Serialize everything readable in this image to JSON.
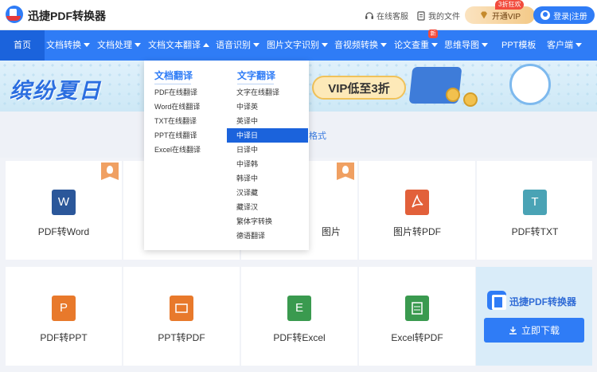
{
  "header": {
    "app_name": "迅捷PDF转换器",
    "online_service": "在线客服",
    "my_files": "我的文件",
    "vip_button": "开通VIP",
    "vip_badge": "3折狂欢",
    "login": "登录|注册"
  },
  "nav": {
    "items": [
      {
        "label": "首页"
      },
      {
        "label": "文档转换"
      },
      {
        "label": "文档处理"
      },
      {
        "label": "文档文本翻译"
      },
      {
        "label": "语音识别"
      },
      {
        "label": "图片文字识别"
      },
      {
        "label": "音视频转换"
      },
      {
        "label": "论文查重"
      },
      {
        "label": "思维导图"
      },
      {
        "label": "PPT模板"
      },
      {
        "label": "客户端"
      }
    ],
    "new_badge": "新"
  },
  "banner": {
    "title": "缤纷夏日",
    "vip_text": "VIP低至3折"
  },
  "format_strip_text": "格式",
  "dropdown": {
    "doc_title": "文档翻译",
    "doc_items": [
      "PDF在线翻译",
      "Word在线翻译",
      "TXT在线翻译",
      "PPT在线翻译",
      "Excel在线翻译"
    ],
    "text_title": "文字翻译",
    "text_items": [
      "文字在线翻译",
      "中译英",
      "英译中",
      "中译日",
      "日译中",
      "中译韩",
      "韩译中",
      "汉译藏",
      "藏译汉",
      "繁体字转换",
      "德语翻译"
    ],
    "selected": "中译日"
  },
  "cards": {
    "row1": [
      {
        "label": "PDF转Word",
        "tile": "W",
        "color": "#2b579a"
      },
      {
        "label": "",
        "tile": "",
        "color": ""
      },
      {
        "label": "图片",
        "tile": "",
        "color": ""
      },
      {
        "label": "图片转PDF",
        "tile": "",
        "color": "#e2603a"
      },
      {
        "label": "PDF转TXT",
        "tile": "T",
        "color": "#4aa3b5"
      }
    ],
    "row2": [
      {
        "label": "PDF转PPT",
        "tile": "P",
        "color": "#e8792b"
      },
      {
        "label": "PPT转PDF",
        "tile": "",
        "color": "#e8792b"
      },
      {
        "label": "PDF转Excel",
        "tile": "E",
        "color": "#3a9a4f"
      },
      {
        "label": "Excel转PDF",
        "tile": "",
        "color": "#3a9a4f"
      }
    ]
  },
  "download": {
    "title": "迅捷PDF转换器",
    "button": "立即下载"
  },
  "colors": {
    "primary": "#2f7cf6",
    "nav_active": "#1b63dc",
    "hot": "#f0a062",
    "alert": "#f24c3d"
  }
}
